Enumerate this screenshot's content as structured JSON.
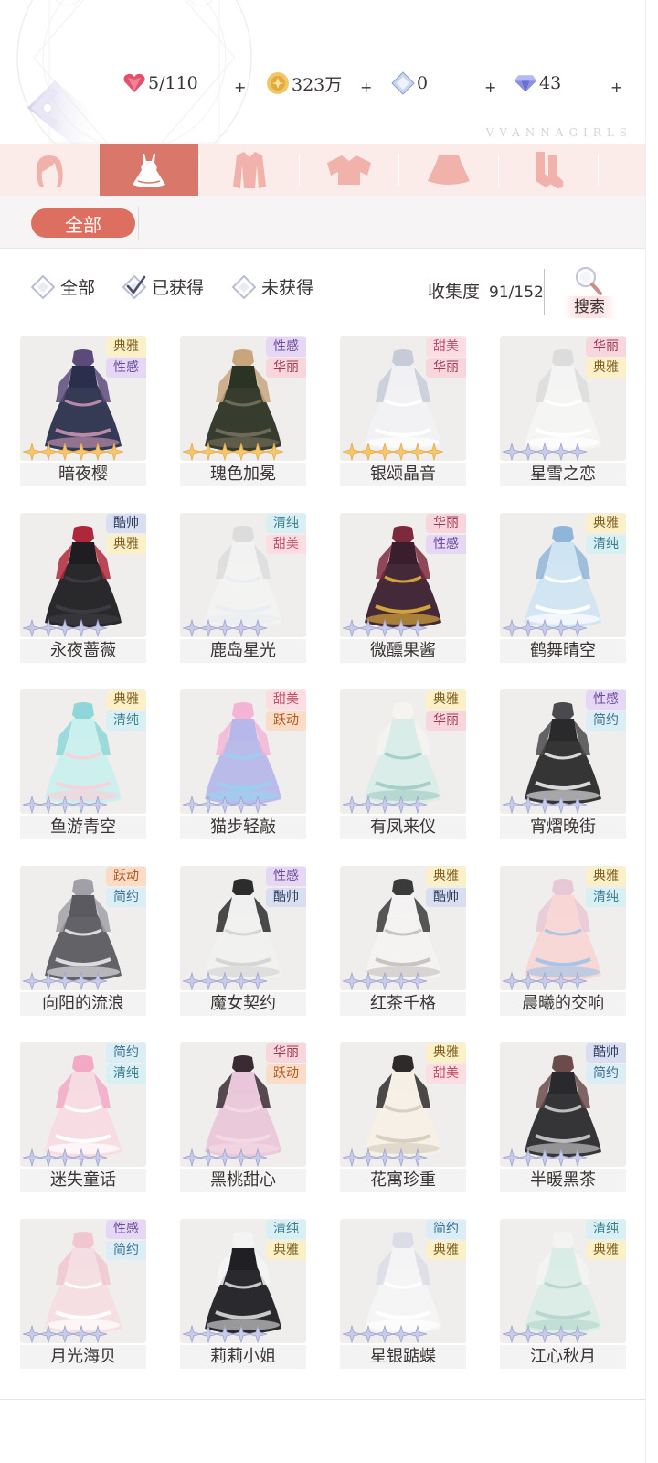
{
  "header": {
    "brand": "VVANNAGIRLS",
    "resources": [
      {
        "id": "stamina",
        "icon": "heart-gem-icon",
        "value": "5/110"
      },
      {
        "id": "gold",
        "icon": "gold-coin-icon",
        "value": "323万"
      },
      {
        "id": "crystal",
        "icon": "crystal-ball-icon",
        "value": "0"
      },
      {
        "id": "diamond",
        "icon": "diamond-icon",
        "value": "43"
      }
    ],
    "plus_label": "+"
  },
  "category_tabs": [
    {
      "icon": "hair-icon",
      "active": false
    },
    {
      "icon": "dress-icon",
      "active": true
    },
    {
      "icon": "coat-icon",
      "active": false
    },
    {
      "icon": "top-icon",
      "active": false
    },
    {
      "icon": "skirt-icon",
      "active": false
    },
    {
      "icon": "socks-icon",
      "active": false
    },
    {
      "icon": "shoes-icon",
      "active": false
    }
  ],
  "sub_filter": {
    "label": "全部"
  },
  "filters": {
    "options": [
      {
        "label": "全部",
        "checked": false
      },
      {
        "label": "已获得",
        "checked": true
      },
      {
        "label": "未获得",
        "checked": false
      }
    ],
    "collect_label": "收集度",
    "collect_value": "91/152",
    "search_label": "搜索"
  },
  "colors": {
    "accent": "#d9786a",
    "tab_bar": "#fbecea",
    "star_gold": "#f3c86c",
    "star_silver": "#c9cce8"
  },
  "items": [
    {
      "name": "暗夜樱",
      "tags": [
        "典雅",
        "性感"
      ],
      "stars": 6,
      "rarity": "gold",
      "palette": [
        "#2a2f4d",
        "#5c4a7a",
        "#b98aa8"
      ]
    },
    {
      "name": "瑰色加冕",
      "tags": [
        "性感",
        "华丽"
      ],
      "stars": 6,
      "rarity": "gold",
      "palette": [
        "#2b3324",
        "#c9a57c",
        "#6d6b57"
      ]
    },
    {
      "name": "银颂晶音",
      "tags": [
        "甜美",
        "华丽"
      ],
      "stars": 6,
      "rarity": "gold",
      "palette": [
        "#f1f1f5",
        "#c7cbd8",
        "#ffffff"
      ]
    },
    {
      "name": "星雪之恋",
      "tags": [
        "华丽",
        "典雅"
      ],
      "stars": 5,
      "rarity": "silver",
      "palette": [
        "#f4f4f4",
        "#dcdcdc",
        "#ffffff"
      ]
    },
    {
      "name": "永夜蔷薇",
      "tags": [
        "酷帅",
        "典雅"
      ],
      "stars": 5,
      "rarity": "silver",
      "palette": [
        "#1e1e22",
        "#b0273a",
        "#3a3a40"
      ]
    },
    {
      "name": "鹿岛星光",
      "tags": [
        "清纯",
        "甜美"
      ],
      "stars": 5,
      "rarity": "silver",
      "palette": [
        "#f2f2f2",
        "#dcdcdc",
        "#e9eef4"
      ]
    },
    {
      "name": "微醺果酱",
      "tags": [
        "华丽",
        "性感"
      ],
      "stars": 5,
      "rarity": "silver",
      "palette": [
        "#3a1e2e",
        "#7d2a3c",
        "#d4a23b"
      ]
    },
    {
      "name": "鹤舞晴空",
      "tags": [
        "典雅",
        "清纯"
      ],
      "stars": 5,
      "rarity": "silver",
      "palette": [
        "#cfe4f3",
        "#8fb5d8",
        "#ffffff"
      ]
    },
    {
      "name": "鱼游青空",
      "tags": [
        "典雅",
        "清纯"
      ],
      "stars": 5,
      "rarity": "silver",
      "palette": [
        "#c9efee",
        "#8ed6d8",
        "#f7d2dc"
      ]
    },
    {
      "name": "猫步轻敲",
      "tags": [
        "甜美",
        "跃动"
      ],
      "stars": 5,
      "rarity": "silver",
      "palette": [
        "#b7b7ea",
        "#f3b5d3",
        "#9ad0ef"
      ]
    },
    {
      "name": "有凤来仪",
      "tags": [
        "典雅",
        "华丽"
      ],
      "stars": 5,
      "rarity": "silver",
      "palette": [
        "#d9ece8",
        "#f6f3f0",
        "#a6cfc7"
      ]
    },
    {
      "name": "宵熠晚街",
      "tags": [
        "性感",
        "简约"
      ],
      "stars": 5,
      "rarity": "silver",
      "palette": [
        "#2a2a2c",
        "#4a4a4e",
        "#d9d9d9"
      ]
    },
    {
      "name": "向阳的流浪",
      "tags": [
        "跃动",
        "简约"
      ],
      "stars": 5,
      "rarity": "silver",
      "palette": [
        "#5a5a60",
        "#a0a0a6",
        "#dcdce0"
      ]
    },
    {
      "name": "魔女契约",
      "tags": [
        "性感",
        "酷帅"
      ],
      "stars": 5,
      "rarity": "silver",
      "palette": [
        "#f0f0f0",
        "#2c2c2c",
        "#d6d6d6"
      ]
    },
    {
      "name": "红茶千格",
      "tags": [
        "典雅",
        "酷帅"
      ],
      "stars": 5,
      "rarity": "silver",
      "palette": [
        "#f4f2f2",
        "#3a3a3a",
        "#c9c4c4"
      ]
    },
    {
      "name": "晨曦的交响",
      "tags": [
        "典雅",
        "清纯"
      ],
      "stars": 5,
      "rarity": "silver",
      "palette": [
        "#f8d6d6",
        "#e8c8d6",
        "#a8c4e6"
      ]
    },
    {
      "name": "迷失童话",
      "tags": [
        "简约",
        "清纯"
      ],
      "stars": 5,
      "rarity": "silver",
      "palette": [
        "#f7dbe3",
        "#f2a9c6",
        "#ffffff"
      ]
    },
    {
      "name": "黑桃甜心",
      "tags": [
        "华丽",
        "跃动"
      ],
      "stars": 5,
      "rarity": "silver",
      "palette": [
        "#e9c6da",
        "#3a2a32",
        "#f3d9e6"
      ]
    },
    {
      "name": "花寓珍重",
      "tags": [
        "典雅",
        "甜美"
      ],
      "stars": 5,
      "rarity": "silver",
      "palette": [
        "#f5efe6",
        "#2e2a2a",
        "#d9cfc0"
      ]
    },
    {
      "name": "半暖黑茶",
      "tags": [
        "酷帅",
        "简约"
      ],
      "stars": 5,
      "rarity": "silver",
      "palette": [
        "#2a2a2e",
        "#6b4b4b",
        "#bdbdbd"
      ]
    },
    {
      "name": "月光海贝",
      "tags": [
        "性感",
        "简约"
      ],
      "stars": 5,
      "rarity": "silver",
      "palette": [
        "#f6dde3",
        "#f1c6d0",
        "#ffffff"
      ]
    },
    {
      "name": "莉莉小姐",
      "tags": [
        "清纯",
        "典雅"
      ],
      "stars": 5,
      "rarity": "silver",
      "palette": [
        "#1f1f24",
        "#f4f4f4",
        "#c9c9c9"
      ]
    },
    {
      "name": "星银踮蝶",
      "tags": [
        "简约",
        "典雅"
      ],
      "stars": 5,
      "rarity": "silver",
      "palette": [
        "#f4f4f6",
        "#dcdce6",
        "#ffffff"
      ]
    },
    {
      "name": "江心秋月",
      "tags": [
        "清纯",
        "典雅"
      ],
      "stars": 5,
      "rarity": "silver",
      "palette": [
        "#d9ece6",
        "#f3f3f1",
        "#b8d8cf"
      ]
    }
  ]
}
